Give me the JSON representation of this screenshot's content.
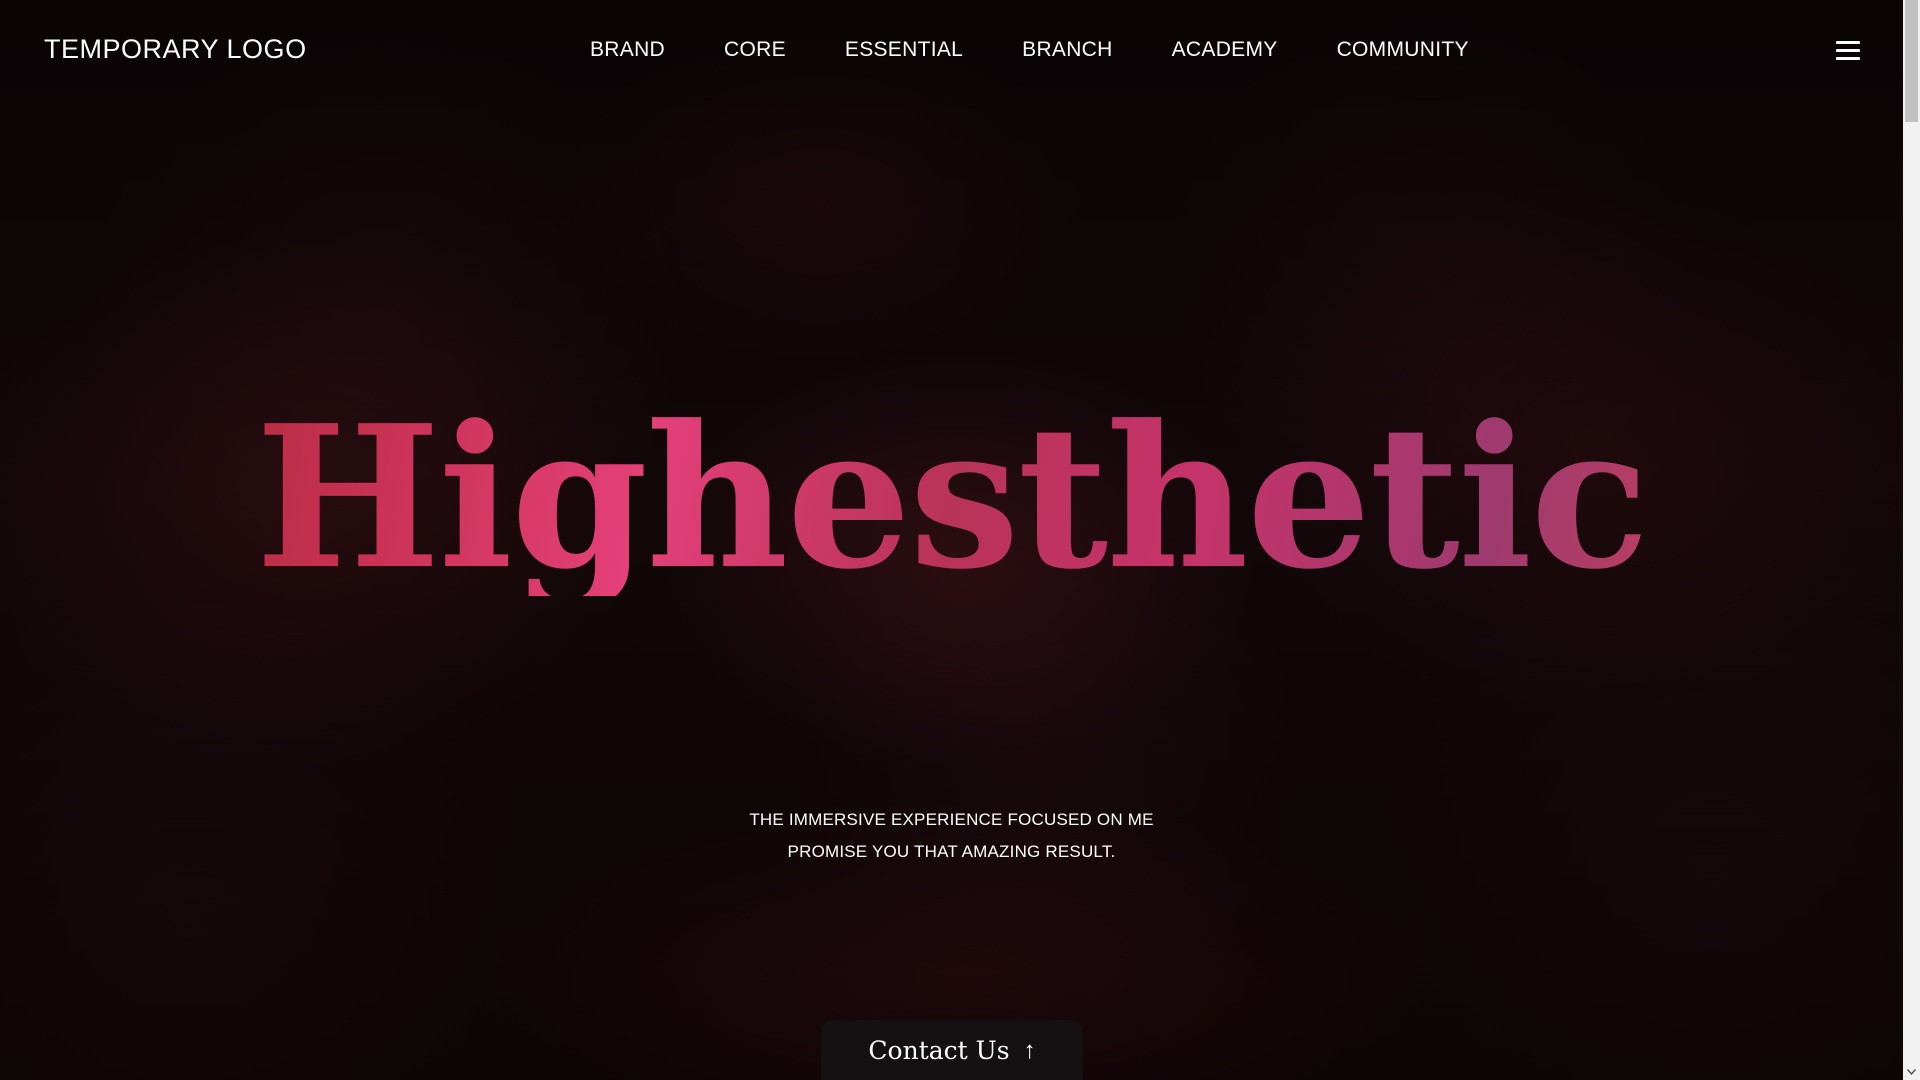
{
  "header": {
    "logo": "TEMPORARY LOGO",
    "nav": [
      {
        "label": "BRAND"
      },
      {
        "label": "CORE"
      },
      {
        "label": "ESSENTIAL"
      },
      {
        "label": "BRANCH"
      },
      {
        "label": "ACADEMY"
      },
      {
        "label": "COMMUNITY"
      }
    ],
    "menu_icon": "hamburger-menu-icon"
  },
  "hero": {
    "title": "Highesthetic",
    "subtitle_line1": "THE IMMERSIVE EXPERIENCE FOCUSED ON ME",
    "subtitle_line2": "PROMISE YOU THAT AMAZING RESULT."
  },
  "contact": {
    "label": "Contact Us",
    "arrow": "↑",
    "icon": "arrow-up-icon"
  },
  "colors": {
    "background": "#0b0506",
    "title_gradient_start": "#9a2a33",
    "title_gradient_mid": "#e4407a",
    "title_gradient_end": "#9e3a6e",
    "text": "#ffffff",
    "contact_bg": "#151011"
  }
}
